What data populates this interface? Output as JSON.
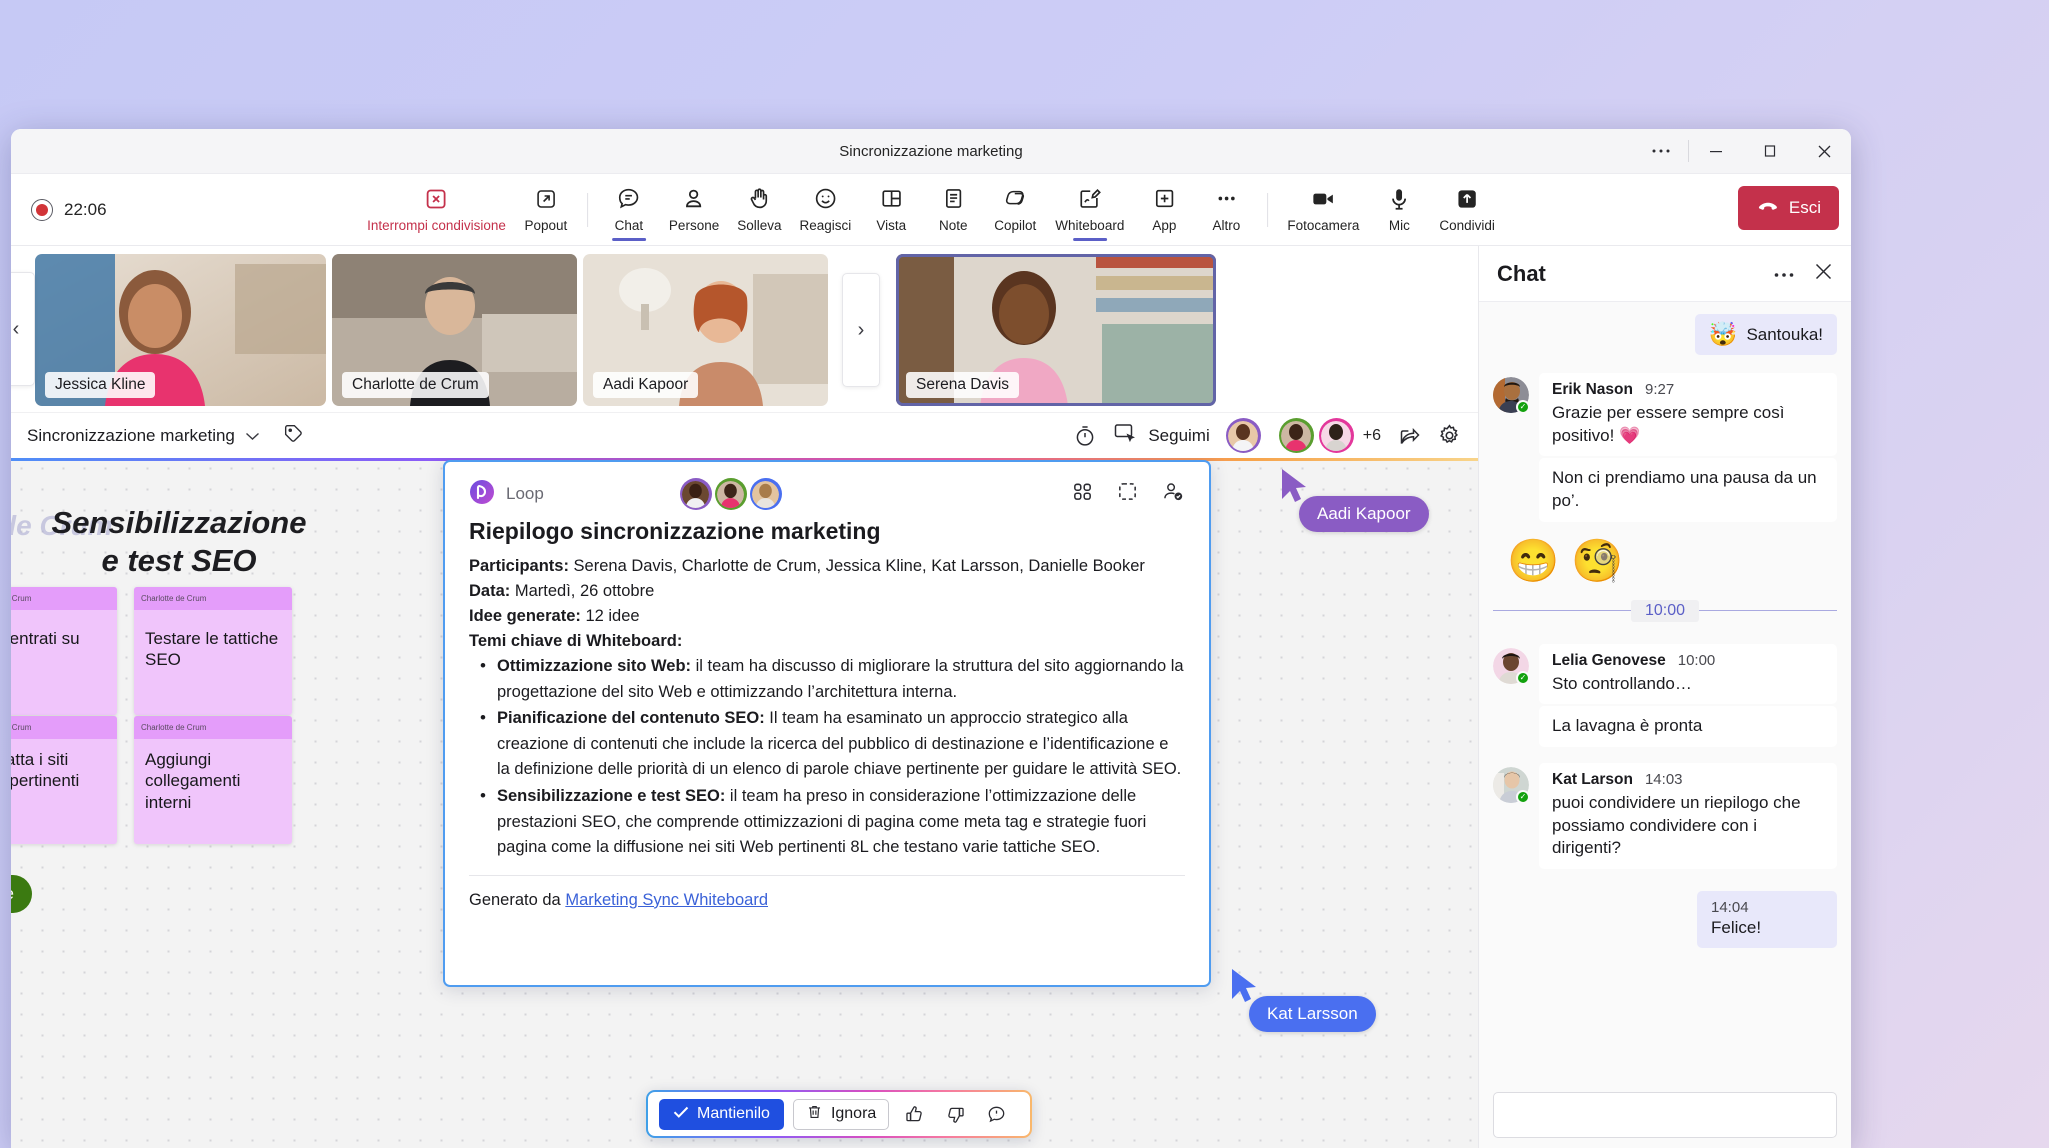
{
  "window": {
    "title": "Sincronizzazione marketing",
    "more_tooltip": "Altre opzioni",
    "minimize": "–",
    "maximize": "□",
    "close": "✕"
  },
  "meeting_toolbar": {
    "recording_time": "22:06",
    "buttons": [
      {
        "label": "Interrompi condivisione",
        "icon": "stop-sharing-icon",
        "state": "danger"
      },
      {
        "label": "Popout",
        "icon": "popout-icon",
        "state": "normal"
      },
      {
        "label": "Chat",
        "icon": "chat-icon",
        "state": "active"
      },
      {
        "label": "Persone",
        "icon": "people-icon",
        "state": "normal"
      },
      {
        "label": "Solleva",
        "icon": "raise-hand-icon",
        "state": "normal"
      },
      {
        "label": "Reagisci",
        "icon": "react-smiley-icon",
        "state": "normal"
      },
      {
        "label": "Vista",
        "icon": "view-layout-icon",
        "state": "normal"
      },
      {
        "label": "Note",
        "icon": "notes-icon",
        "state": "normal"
      },
      {
        "label": "Copilot",
        "icon": "copilot-icon",
        "state": "normal"
      },
      {
        "label": "Whiteboard",
        "icon": "whiteboard-icon",
        "state": "active"
      },
      {
        "label": "App",
        "icon": "apps-plus-icon",
        "state": "normal"
      },
      {
        "label": "Altro",
        "icon": "more-ellipsis-icon",
        "state": "normal"
      },
      {
        "label": "Fotocamera",
        "icon": "camera-icon",
        "state": "normal"
      },
      {
        "label": "Mic",
        "icon": "microphone-icon",
        "state": "normal"
      },
      {
        "label": "Condividi",
        "icon": "share-screen-icon",
        "state": "normal"
      }
    ],
    "leave_label": "Esci"
  },
  "filmstrip": {
    "prev_arrow": "‹",
    "next_arrow": "›",
    "tiles": [
      {
        "name": "Jessica Kline",
        "speaking": false
      },
      {
        "name": "Charlotte de Crum",
        "speaking": false
      },
      {
        "name": "Aadi Kapoor",
        "speaking": false
      },
      {
        "name": "Serena Davis",
        "speaking": true
      }
    ]
  },
  "whiteboard_bar": {
    "title": "Sincronizzazione marketing",
    "chevron": "⌄",
    "tag_icon": "tag-icon",
    "timer_icon": "timer-icon",
    "follow_icon": "follow-cursor-icon",
    "follow_label": "Seguimi",
    "overflow_count": "+6",
    "share_icon": "share-arrow-icon",
    "settings_icon": "gear-icon"
  },
  "whiteboard": {
    "heading_line1": "Sensibilizzazione",
    "heading_line2": "e test SEO",
    "ghost_author": "de Crum",
    "notes": [
      {
        "author": "Charlotte de Crum",
        "text": "Concentrati su SEO"
      },
      {
        "author": "Charlotte de Crum",
        "text": "Testare le tattiche SEO"
      },
      {
        "author": "Charlotte de Crum",
        "text": "Contatta i siti Web pertinenti"
      },
      {
        "author": "Charlotte de Crum",
        "text": "Aggiungi collegamenti interni"
      }
    ],
    "green_pill": "ne",
    "cursors": [
      {
        "name": "Aadi Kapoor",
        "color": "#8a5cc4"
      },
      {
        "name": "Kat Larsson",
        "color": "#4a6ff0"
      }
    ]
  },
  "loop_card": {
    "app_name": "Loop",
    "app_icon": "loop-icon",
    "tools": [
      {
        "icon": "grid-apps-icon"
      },
      {
        "icon": "expand-focus-icon"
      },
      {
        "icon": "people-check-icon"
      }
    ],
    "title": "Riepilogo sincronizzazione marketing",
    "meta": [
      {
        "label": "Participants:",
        "value": " Serena Davis, Charlotte de Crum, Jessica Kline, Kat Larsson, Danielle Booker"
      },
      {
        "label": "Data:",
        "value": " Martedì, 26 ottobre"
      },
      {
        "label": "Idee generate:",
        "value": " 12 idee"
      }
    ],
    "themes_label": "Temi chiave di Whiteboard:",
    "bullets": [
      {
        "term": "Ottimizzazione sito Web:",
        "text": " il team ha discusso di migliorare la struttura del sito aggiornando la progettazione del sito Web e ottimizzando l’architettura interna."
      },
      {
        "term": "Pianificazione del contenuto SEO:",
        "text": " Il team ha esaminato un approccio strategico alla creazione di contenuti che include la ricerca del pubblico di destinazione e l’identificazione e la definizione delle priorità di un elenco di parole chiave pertinente per guidare le attività SEO."
      },
      {
        "term": "Sensibilizzazione e test SEO:",
        "text": " il team ha preso in considerazione l’ottimizzazione delle prestazioni SEO, che comprende ottimizzazioni di pagina come meta tag e strategie fuori pagina come la diffusione nei siti Web pertinenti 8L che testano varie tattiche SEO."
      }
    ],
    "footer_prefix": "Generato da ",
    "footer_link": "Marketing Sync Whiteboard"
  },
  "action_bar": {
    "keep_label": "Mantienilo",
    "keep_icon": "check-icon",
    "discard_label": "Ignora",
    "discard_icon": "trash-icon",
    "thumbs_up_icon": "thumbs-up-icon",
    "thumbs_down_icon": "thumbs-down-icon",
    "feedback_icon": "feedback-bubble-icon"
  },
  "chat": {
    "title": "Chat",
    "more_icon": "more-ellipsis-icon",
    "close_icon": "close-icon",
    "messages": [
      {
        "kind": "outgoing",
        "emoji": "🤯",
        "text": "Santouka!"
      },
      {
        "kind": "incoming",
        "author": "Erik Nason",
        "time": "9:27",
        "lines": [
          "Grazie per essere sempre così positivo! 💗",
          "Non ci prendiamo una pausa da un po’."
        ]
      },
      {
        "kind": "reactions",
        "emojis": [
          "😁",
          "🧐"
        ]
      },
      {
        "kind": "divider",
        "label": "10:00"
      },
      {
        "kind": "incoming",
        "author": "Lelia Genovese",
        "time": "10:00",
        "lines": [
          "Sto controllando…",
          "La lavagna è pronta"
        ]
      },
      {
        "kind": "incoming",
        "author": "Kat Larson",
        "time": "14:03",
        "lines": [
          "puoi condividere un riepilogo che possiamo condividere con i dirigenti?"
        ]
      },
      {
        "kind": "self",
        "time": "14:04",
        "text": "Felice!"
      }
    ]
  },
  "colors": {
    "accent": "#5b5fc7",
    "danger": "#c4314b",
    "keep_blue": "#1f4fe0",
    "note_purple": "#f0c5fb",
    "note_header": "#e49dfa",
    "presence_green": "#13a10e"
  }
}
